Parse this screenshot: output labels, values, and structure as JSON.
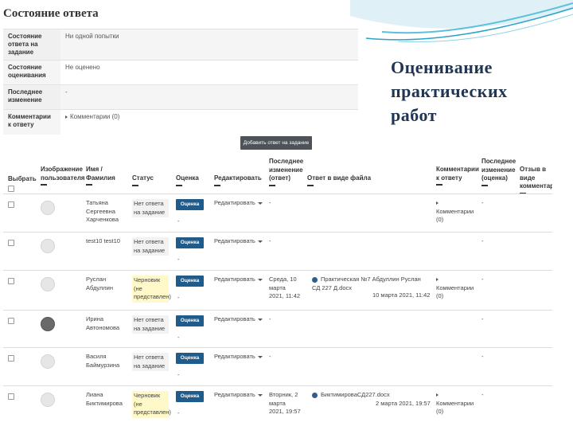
{
  "slide": {
    "title_lines": [
      "Оценивание",
      "практических",
      "работ"
    ]
  },
  "status_section": {
    "heading": "Состояние ответа",
    "rows": [
      {
        "label": "Состояние ответа на задание",
        "value": "Ни одной попытки"
      },
      {
        "label": "Состояние оценивания",
        "value": "Не оценено"
      },
      {
        "label": "Последнее изменение",
        "value": "-"
      },
      {
        "label": "Комментарии к ответу",
        "value": "Комментарии (0)"
      }
    ]
  },
  "add_button_label": "Добавить ответ на задание",
  "table": {
    "headers": {
      "select": "Выбрать",
      "avatar": "Изображение пользователя",
      "name": "Имя / Фамилия",
      "status": "Статус",
      "grade": "Оценка",
      "edit": "Редактировать",
      "last_modified": "Последнее изменение (ответ)",
      "file": "Ответ в виде файла",
      "comments": "Комментарии к ответу",
      "last_modified_grade": "Последнее изменение (оценка)",
      "feedback": "Отзыв в виде комментари"
    },
    "grade_button": "Оценка",
    "edit_label": "Редактировать",
    "rows": [
      {
        "name": "Татьяна Сергеевна Харченкова",
        "status": "Нет ответа на задание",
        "status_type": "none",
        "grade_dash": "-",
        "last_modified": "-",
        "file_name": "",
        "file_date": "",
        "comments": "Комментарии (0)",
        "grade_modified": "-",
        "has_photo": false
      },
      {
        "name": "test10 test10",
        "status": "Нет ответа на задание",
        "status_type": "none",
        "grade_dash": "-",
        "last_modified": "-",
        "file_name": "",
        "file_date": "",
        "comments": "",
        "grade_modified": "-",
        "has_photo": false
      },
      {
        "name": "Руслан Абдуллин",
        "status": "Черновик (не представлен)",
        "status_type": "draft",
        "grade_dash": "-",
        "last_modified": "Среда, 10 марта 2021, 11:42",
        "file_name": "Практическая №7 Абдуллин Руслан СД 227 Д.docx",
        "file_date": "10 марта 2021, 11:42",
        "comments": "Комментарии (0)",
        "grade_modified": "-",
        "has_photo": false
      },
      {
        "name": "Ирина Автономова",
        "status": "Нет ответа на задание",
        "status_type": "none",
        "grade_dash": "-",
        "last_modified": "-",
        "file_name": "",
        "file_date": "",
        "comments": "",
        "grade_modified": "-",
        "has_photo": true
      },
      {
        "name": "Василя Баймурзина",
        "status": "Нет ответа на задание",
        "status_type": "none",
        "grade_dash": "-",
        "last_modified": "-",
        "file_name": "",
        "file_date": "",
        "comments": "",
        "grade_modified": "-",
        "has_photo": false
      },
      {
        "name": "Лиана Биктимирова",
        "status": "Черновик (не представлен)",
        "status_type": "draft",
        "grade_dash": "-",
        "last_modified": "Вторник, 2 марта 2021, 19:57",
        "file_name": "БиктимироваСД227.docx",
        "file_date": "2 марта 2021, 19:57",
        "comments": "Комментарии (0)",
        "grade_modified": "-",
        "has_photo": false
      }
    ]
  },
  "colors": {
    "accent_button": "#1f5c8c",
    "dark_button": "#4d5358",
    "draft_highlight": "#fff8c8",
    "title_color": "#1f3550"
  }
}
